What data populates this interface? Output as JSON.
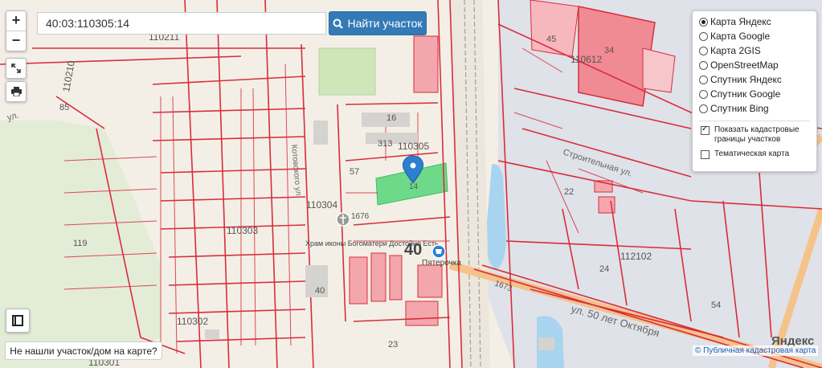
{
  "controls": {
    "zoom_in": "+",
    "zoom_out": "−",
    "fullscreen_icon": "expand-icon",
    "print_icon": "printer-icon",
    "legend_icon": "book-icon"
  },
  "search": {
    "value": "40:03:110305:14",
    "button_label": "Найти участок"
  },
  "layers": {
    "options": [
      {
        "label": "Карта Яндекс",
        "selected": true
      },
      {
        "label": "Карта Google",
        "selected": false
      },
      {
        "label": "Карта 2GIS",
        "selected": false
      },
      {
        "label": "OpenStreetMap",
        "selected": false
      },
      {
        "label": "Спутник Яндекс",
        "selected": false
      },
      {
        "label": "Спутник Google",
        "selected": false
      },
      {
        "label": "Спутник Bing",
        "selected": false
      }
    ],
    "show_cadastral": "Показать кадастровые границы участков",
    "thematic_map": "Тематическая карта"
  },
  "not_found_button": "Не нашли участок/дом на карте?",
  "attribution": "© Публичная кадастровая карта",
  "map_logo": "Яндекс",
  "colors": {
    "background": "#f2eee6",
    "parcel_line": "#d92c3c",
    "highlight": "#6fd98a",
    "industrial": "#dde0e6",
    "marker": "#2d7fd1",
    "water": "#a9d4ef"
  },
  "map_labels": {
    "quarter_110305": "110305",
    "quarter_110304": "110304",
    "quarter_110303": "110303",
    "quarter_110302": "110302",
    "quarter_110301": "110301",
    "quarter_110211": "110211",
    "quarter_110210": "110210",
    "quarter_110612": "110612",
    "quarter_112102": "112102",
    "parcel_14": "14",
    "parcel_57": "57",
    "parcel_16": "16",
    "parcel_313": "313",
    "parcel_40": "40",
    "parcel_119": "119",
    "parcel_24": "24",
    "parcel_54": "54",
    "parcel_45": "45",
    "parcel_34": "34",
    "parcel_22": "22",
    "parcel_23": "23",
    "parcel_85": "85",
    "parcel_1676": "1676",
    "parcel_1673": "1673",
    "street_stroitelnaya": "Строительная ул.",
    "street_50_let": "ул. 50 лет Октября",
    "street_kotovskogo": "Котовского ул.",
    "street_ul": "ул.",
    "poi_church": "Храм иконы Богоматери Достойно Есть",
    "poi_pyaterochka": "Пятерочка",
    "house_40": "40"
  }
}
